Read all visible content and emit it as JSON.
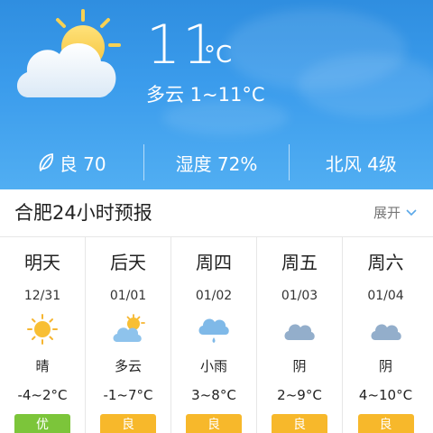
{
  "current": {
    "temperature": "11",
    "unit": "°C",
    "description": "多云 1~11°C",
    "icon": "partly-cloudy-icon"
  },
  "stats": {
    "air_quality": "良 70",
    "humidity": "湿度 72%",
    "wind": "北风 4级"
  },
  "forecast": {
    "title": "合肥24小时预报",
    "expand_label": "展开",
    "days": [
      {
        "name": "明天",
        "date": "12/31",
        "icon": "sunny-icon",
        "condition": "晴",
        "temp": "-4~2°C",
        "aqi": "优",
        "aqi_color": "#7cc53a"
      },
      {
        "name": "后天",
        "date": "01/01",
        "icon": "partly-cloudy-icon",
        "condition": "多云",
        "temp": "-1~7°C",
        "aqi": "良",
        "aqi_color": "#f7b82b"
      },
      {
        "name": "周四",
        "date": "01/02",
        "icon": "light-rain-icon",
        "condition": "小雨",
        "temp": "3~8°C",
        "aqi": "良",
        "aqi_color": "#f7b82b"
      },
      {
        "name": "周五",
        "date": "01/03",
        "icon": "overcast-icon",
        "condition": "阴",
        "temp": "2~9°C",
        "aqi": "良",
        "aqi_color": "#f7b82b"
      },
      {
        "name": "周六",
        "date": "01/04",
        "icon": "overcast-icon",
        "condition": "阴",
        "temp": "4~10°C",
        "aqi": "良",
        "aqi_color": "#f7b82b"
      }
    ]
  },
  "colors": {
    "header_top": "#2f8ee0",
    "header_bottom": "#51aef2",
    "aqi_excellent": "#7cc53a",
    "aqi_good": "#f7b82b"
  }
}
